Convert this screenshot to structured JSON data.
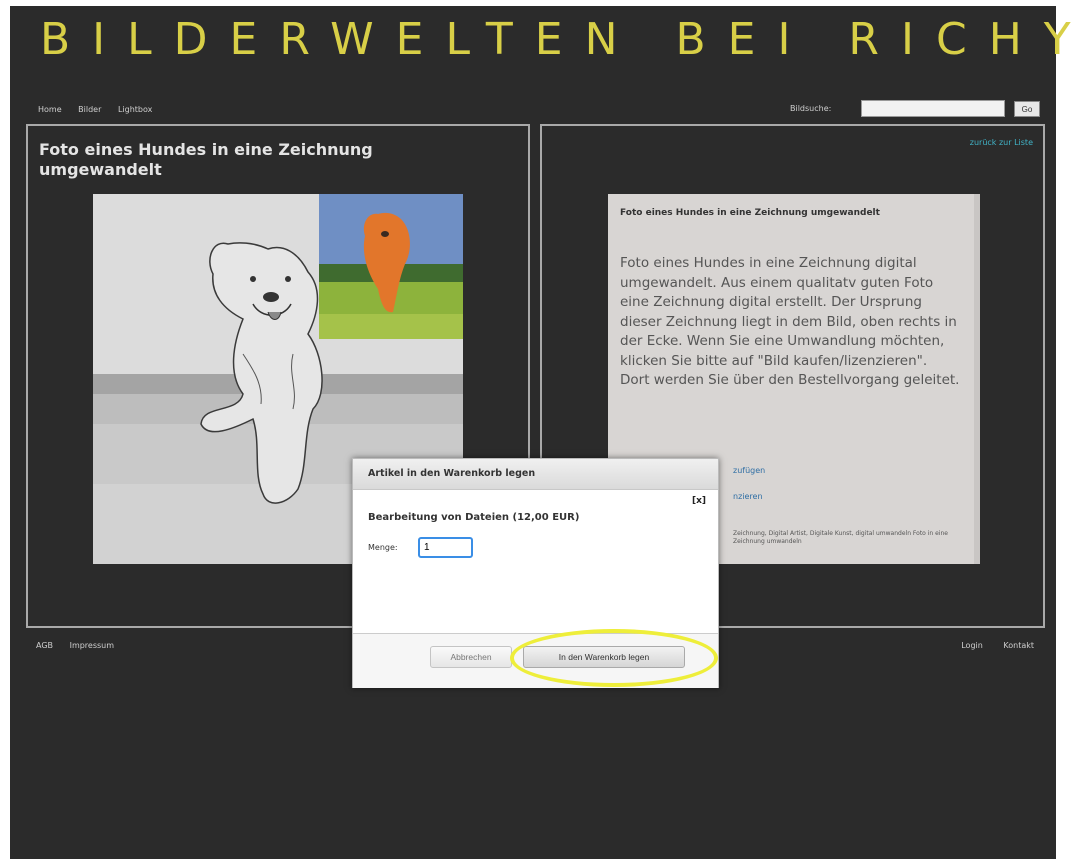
{
  "header": {
    "site_title": "BILDERWELTEN BEI RICHY",
    "nav": [
      "Home",
      "Bilder",
      "Lightbox"
    ],
    "search_label": "Bildsuche:",
    "search_value": "",
    "search_button": "Go"
  },
  "left_panel": {
    "title": "Foto eines Hundes in eine Zeichnung umgewandelt"
  },
  "right_panel": {
    "back_link": "zurück zur Liste",
    "card_title": "Foto eines Hundes in eine Zeichnung umgewandelt",
    "card_description": "Foto eines Hundes in eine Zeichnung digital umgewandelt. Aus einem qualitatv guten Foto eine Zeichnung digital erstellt. Der Ursprung dieser Zeichnung liegt in dem Bild, oben rechts in der Ecke. Wenn Sie eine Umwandlung möchten, klicken Sie bitte auf \"Bild kaufen/lizenzieren\". Dort werden Sie über den Bestellvorgang geleitet.",
    "link_add": "zufügen",
    "link_license": "nzieren",
    "tags": "Zeichnung, Digital Artist, Digitale Kunst, digital umwandeln Foto in eine Zeichnung umwandeln"
  },
  "footer": {
    "left_links": [
      "AGB",
      "Impressum"
    ],
    "right_links": [
      "Login",
      "Kontakt"
    ]
  },
  "dialog": {
    "title": "Artikel in den Warenkorb legen",
    "close": "[x]",
    "heading": "Bearbeitung von Dateien (12,00 EUR)",
    "quantity_label": "Menge:",
    "quantity_value": "1",
    "cancel_label": "Abbrechen",
    "add_to_cart_label": "In den Warenkorb legen"
  },
  "colors": {
    "background": "#2b2b2b",
    "title_yellow": "#d8cf47",
    "link_teal": "#41b3c7",
    "highlight_yellow": "#eeee3a"
  }
}
